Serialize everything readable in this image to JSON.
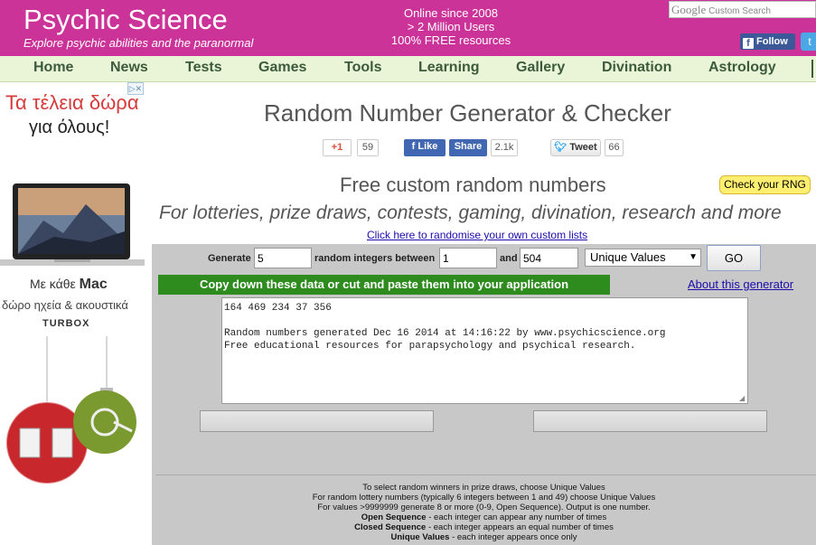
{
  "header": {
    "title": "Psychic Science",
    "tagline": "Explore psychic abilities and the paranormal",
    "stats": [
      "Online since 2008",
      "> 2 Million Users",
      "100% FREE resources"
    ],
    "search_logo": "Google",
    "search_placeholder": "Custom Search",
    "follow_label": "Follow",
    "brand_color": "#cc3399"
  },
  "nav": {
    "items": [
      "Home",
      "News",
      "Tests",
      "Games",
      "Tools",
      "Learning",
      "Gallery",
      "Divination",
      "Astrology"
    ]
  },
  "ad": {
    "headline1": "Τα τέλεια δώρα",
    "headline2": "για όλους!",
    "mac_prefix": "Με κάθε",
    "mac_word": "Mac",
    "subline": "δώρο ηχεία & ακουστικά",
    "brand": "TURBOX"
  },
  "main": {
    "title": "Random Number Generator & Checker",
    "share": {
      "gplus_label": "+1",
      "gplus_count": "59",
      "fb_like": "Like",
      "fb_share": "Share",
      "fb_count": "2.1k",
      "tweet_label": "Tweet",
      "tweet_count": "66"
    },
    "check_rng": "Check your RNG",
    "subtitle": "Free custom random numbers",
    "subtitle2": "For lotteries, prize draws, contests, gaming, divination, research and more",
    "randomise_link": "Click here to randomise your own custom lists"
  },
  "generator": {
    "generate_label": "Generate",
    "count_value": "5",
    "between_label": "random integers between",
    "min_value": "1",
    "and_label": "and",
    "max_value": "504",
    "mode_selected": "Unique Values",
    "go_label": "GO",
    "instruction": "Copy down these data or cut and paste them into your application",
    "about_link": "About this generator",
    "output_text": "164 469 234 37 356\n\nRandom numbers generated Dec 16 2014 at 14:16:22 by www.psychicscience.org\nFree educational resources for parapsychology and psychical research."
  },
  "info": {
    "line1": "To select random winners in prize draws, choose Unique Values",
    "line2": "For random lottery numbers (typically 6 integers between 1 and 49) choose Unique Values",
    "line3": "For values >9999999 generate 8 or more (0-9, Open Sequence). Output is one number.",
    "line4_bold": "Open Sequence",
    "line4_rest": " - each integer can appear any number of times",
    "line5_bold": "Closed Sequence",
    "line5_rest": " - each integer appears an equal number of times",
    "line6_bold": "Unique Values",
    "line6_rest": " - each integer appears once only"
  }
}
